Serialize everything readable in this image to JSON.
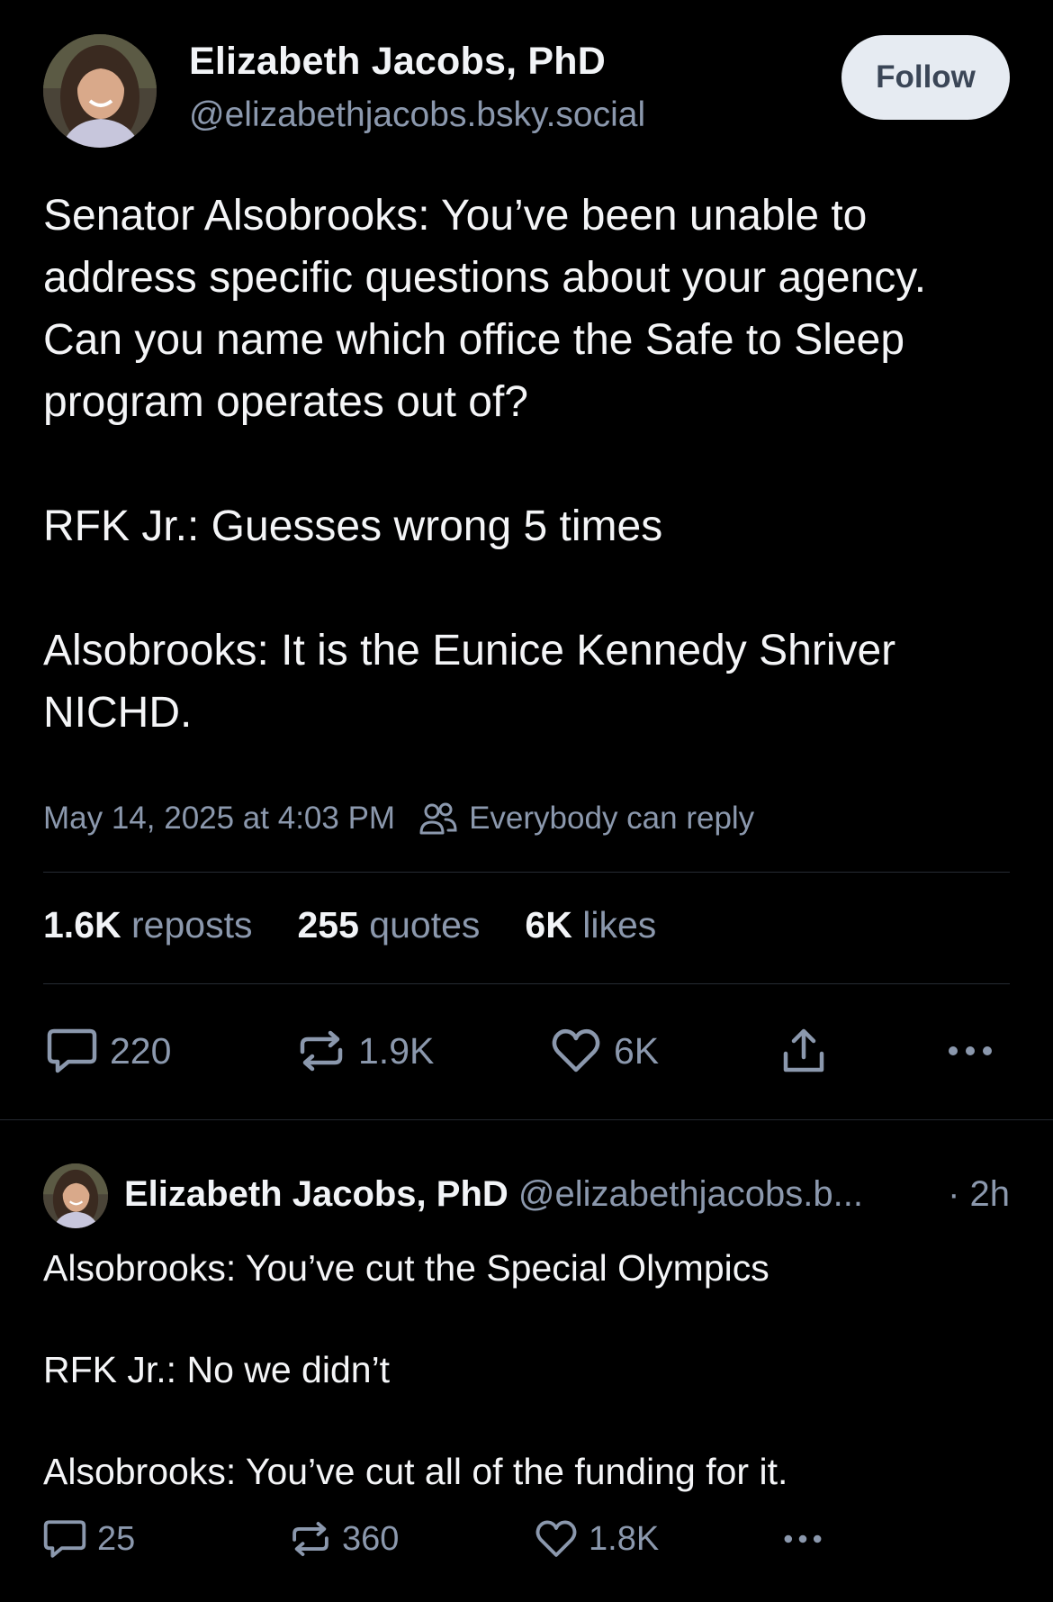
{
  "post": {
    "author": {
      "name": "Elizabeth Jacobs, PhD",
      "handle": "@elizabethjacobs.bsky.social"
    },
    "follow_label": "Follow",
    "paragraphs": [
      "Senator Alsobrooks: You’ve been unable to address specific questions about your agency. Can you name which office the Safe to Sleep program operates out of?",
      "RFK Jr.: Guesses wrong 5 times",
      "Alsobrooks: It is the Eunice Kennedy Shriver NICHD."
    ],
    "timestamp": "May 14, 2025 at 4:03 PM",
    "reply_setting": "Everybody can reply",
    "stats": {
      "reposts_count": "1.6K",
      "reposts_label": "reposts",
      "quotes_count": "255",
      "quotes_label": "quotes",
      "likes_count": "6K",
      "likes_label": "likes"
    },
    "actions": {
      "replies": "220",
      "reposts": "1.9K",
      "likes": "6K"
    }
  },
  "reply": {
    "author_name": "Elizabeth Jacobs, PhD",
    "author_handle": "@elizabethjacobs.b...",
    "time": "· 2h",
    "paragraphs": [
      "Alsobrooks: You’ve cut the Special Olympics",
      "RFK Jr.: No we didn’t",
      "Alsobrooks: You’ve cut all of the funding for it."
    ],
    "actions": {
      "replies": "25",
      "reposts": "360",
      "likes": "1.8K"
    }
  },
  "icons": {
    "reply": "speech-bubble-icon",
    "repost": "repost-arrows-icon",
    "like": "heart-icon",
    "share": "share-upload-icon",
    "more": "ellipsis-icon",
    "audience": "people-icon"
  },
  "colors": {
    "background": "#000000",
    "text_primary": "#f4f5f7",
    "text_secondary": "#8b98ad",
    "follow_button_bg": "#e6ebf2",
    "follow_button_text": "#3b4657"
  }
}
